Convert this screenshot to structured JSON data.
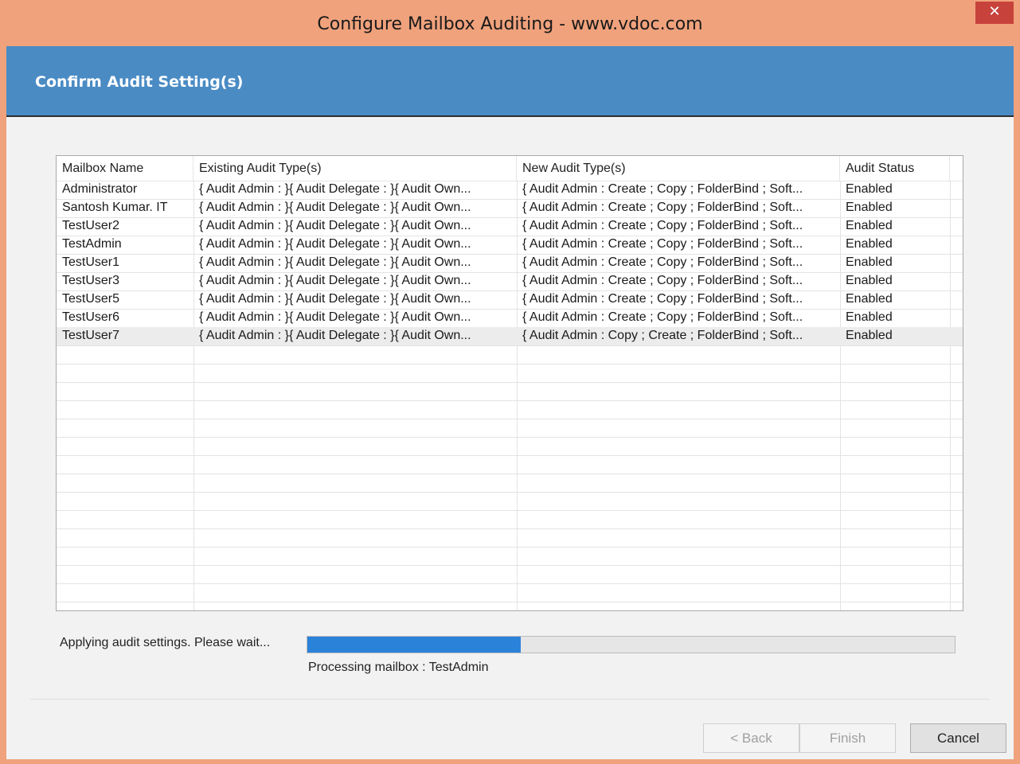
{
  "window": {
    "title": "Configure Mailbox Auditing - www.vdoc.com",
    "close_glyph": "✕"
  },
  "banner": {
    "title": "Confirm Audit Setting(s)"
  },
  "table": {
    "columns": [
      "Mailbox Name",
      "Existing Audit Type(s)",
      "New Audit Type(s)",
      "Audit Status"
    ],
    "rows": [
      {
        "name": "Administrator",
        "existing": "{ Audit Admin : }{ Audit Delegate : }{ Audit Own...",
        "new": "{ Audit Admin : Create ; Copy ; FolderBind ; Soft...",
        "status": "Enabled"
      },
      {
        "name": "Santosh Kumar. IT",
        "existing": "{ Audit Admin : }{ Audit Delegate : }{ Audit Own...",
        "new": "{ Audit Admin : Create ; Copy ; FolderBind ; Soft...",
        "status": "Enabled"
      },
      {
        "name": "TestUser2",
        "existing": "{ Audit Admin : }{ Audit Delegate : }{ Audit Own...",
        "new": "{ Audit Admin : Create ; Copy ; FolderBind ; Soft...",
        "status": "Enabled"
      },
      {
        "name": "TestAdmin",
        "existing": "{ Audit Admin : }{ Audit Delegate : }{ Audit Own...",
        "new": "{ Audit Admin : Create ; Copy ; FolderBind ; Soft...",
        "status": "Enabled"
      },
      {
        "name": "TestUser1",
        "existing": "{ Audit Admin : }{ Audit Delegate : }{ Audit Own...",
        "new": "{ Audit Admin : Create ; Copy ; FolderBind ; Soft...",
        "status": "Enabled"
      },
      {
        "name": "TestUser3",
        "existing": "{ Audit Admin : }{ Audit Delegate : }{ Audit Own...",
        "new": "{ Audit Admin : Create ; Copy ; FolderBind ; Soft...",
        "status": "Enabled"
      },
      {
        "name": "TestUser5",
        "existing": "{ Audit Admin : }{ Audit Delegate : }{ Audit Own...",
        "new": "{ Audit Admin : Create ; Copy ; FolderBind ; Soft...",
        "status": "Enabled"
      },
      {
        "name": "TestUser6",
        "existing": "{ Audit Admin : }{ Audit Delegate : }{ Audit Own...",
        "new": "{ Audit Admin : Create ; Copy ; FolderBind ; Soft...",
        "status": "Enabled"
      },
      {
        "name": "TestUser7",
        "existing": "{ Audit Admin : }{ Audit Delegate : }{ Audit Own...",
        "new": "{ Audit Admin : Copy ; Create ; FolderBind ; Soft...",
        "status": "Enabled"
      }
    ],
    "selected_index": 8
  },
  "progress": {
    "label": "Applying audit settings. Please wait...",
    "fraction": 0.33,
    "processing_text": "Processing mailbox : TestAdmin"
  },
  "buttons": {
    "back": "< Back",
    "finish": "Finish",
    "cancel": "Cancel"
  },
  "colors": {
    "title_bar": "#f0a27c",
    "banner": "#4a8bc4",
    "progress_fill": "#2b82d9",
    "close_button": "#c8423c"
  }
}
